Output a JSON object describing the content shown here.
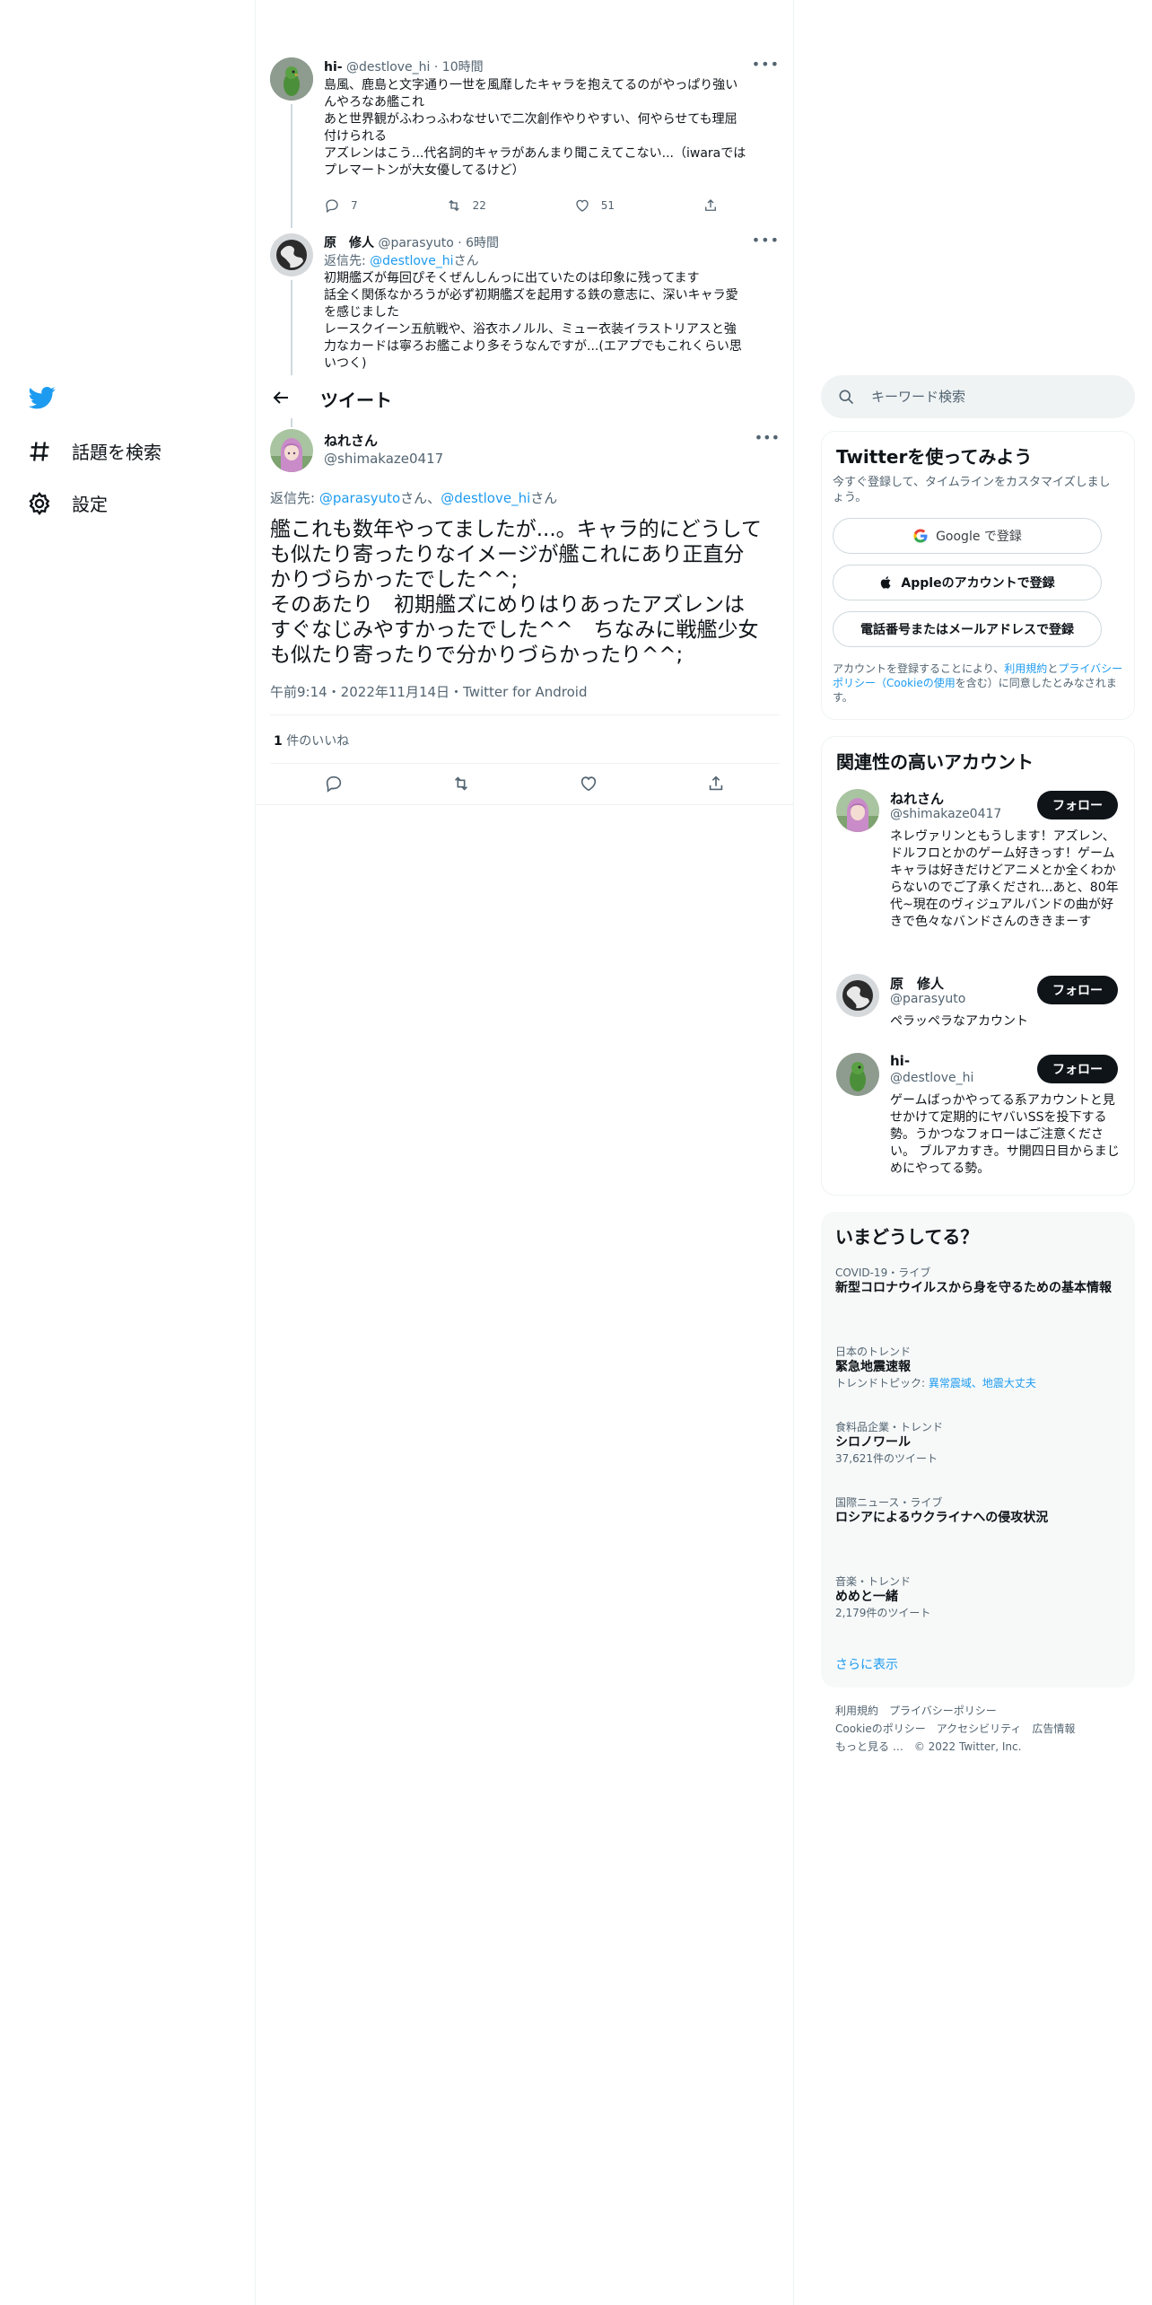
{
  "nav": {
    "explore_label": "話題を検索",
    "settings_label": "設定"
  },
  "thread": [
    {
      "name": "hi-",
      "handle": "@destlove_hi",
      "time": "10時間",
      "lines": [
        "島風、鹿島と文字通り一世を風靡したキャラを抱えてるのがやっぱり強い",
        "んやろなあ艦これ",
        "あと世界観がふわっふわなせいで二次創作やりやすい、何やらせても理屈",
        "付けられる",
        "アズレンはこう...代名詞的キャラがあんまり聞こえてこない...（iwaraでは",
        "プレマートンが大女優してるけど）"
      ],
      "replies": "7",
      "retweets": "22",
      "likes": "51"
    },
    {
      "name": "原　修人",
      "handle": "@parasyuto",
      "time": "6時間",
      "reply_prefix": "返信先: ",
      "reply_to": "@destlove_hi",
      "reply_suffix": "さん",
      "lines": [
        "初期艦ズが毎回ぴそくぜんしんっに出ていたのは印象に残ってます",
        "話全く関係なかろうが必ず初期艦ズを起用する鉄の意志に、深いキャラ愛",
        "を感じました",
        "レースクイーン五航戦や、浴衣ホノルル、ミュー衣装イラストリアスと強",
        "力なカードは寧ろお艦こより多そうなんですが...(エアプでもこれくらい思",
        "いつく)"
      ]
    }
  ],
  "header": {
    "title": "ツイート"
  },
  "focus": {
    "name": "ねれさん",
    "handle": "@shimakaze0417",
    "reply_prefix": "返信先: ",
    "reply_to_1": "@parasyuto",
    "reply_mid": "さん、",
    "reply_to_2": "@destlove_hi",
    "reply_suffix": "さん",
    "lines": [
      "艦これも数年やってましたが...。キャラ的にどうして",
      "も似たり寄ったりなイメージが艦これにあり正直分",
      "かりづらかったでした^^;",
      "そのあたり　初期艦ズにめりはりあったアズレンは",
      "すぐなじみやすかったでした^^　ちなみに戦艦少女",
      "も似たり寄ったりで分かりづらかったり^^;"
    ],
    "meta": "午前9:14・2022年11月14日・Twitter for Android",
    "likes_count": "1",
    "likes_label": " 件のいいね"
  },
  "search": {
    "placeholder": "キーワード検索"
  },
  "signup": {
    "title": "Twitterを使ってみよう",
    "desc": "今すぐ登録して、タイムラインをカスタマイズしましょう。",
    "google": "Google で登録",
    "apple": "Appleのアカウントで登録",
    "phone": "電話番号またはメールアドレスで登録",
    "terms_1": "アカウントを登録することにより、",
    "terms_link_1": "利用規約",
    "terms_2": "と",
    "terms_link_2": "プライバシーポリシー（Cookieの使用",
    "terms_3": "を含む）に同意したとみなされます。"
  },
  "relevant": {
    "title": "関連性の高いアカウント",
    "follow_label": "フォロー",
    "users": [
      {
        "name": "ねれさん",
        "handle": "@shimakaze0417",
        "bio": "ネレヴァリンともうします！アズレン、ドルフロとかのゲーム好きっす！ゲームキャラは好きだけどアニメとか全くわからないのでご了承くだされ...あと、80年代~現在のヴィジュアルバンドの曲が好きで色々なバンドさんのききまーす"
      },
      {
        "name": "原　修人",
        "handle": "@parasyuto",
        "bio": "ペラッペラなアカウント"
      },
      {
        "name": "hi-",
        "handle": "@destlove_hi",
        "bio": "ゲームばっかやってる系アカウントと見せかけて定期的にヤバいSSを投下する勢。うかつなフォローはご注意ください。 ブルアカすき。サ開四日目からまじめにやってる勢。"
      }
    ]
  },
  "trends": {
    "title": "いまどうしてる？",
    "items": [
      {
        "category": "COVID-19・ライブ",
        "title": "新型コロナウイルスから身を守るための基本情報",
        "sub": ""
      },
      {
        "category": "日本のトレンド",
        "title": "緊急地震速報",
        "sub_prefix": "トレンドトピック: ",
        "sub_links": "異常震域、地震大丈夫"
      },
      {
        "category": "食料品企業・トレンド",
        "title": "シロノワール",
        "sub": "37,621件のツイート"
      },
      {
        "category": "国際ニュース・ライブ",
        "title": "ロシアによるウクライナへの侵攻状況",
        "sub": ""
      },
      {
        "category": "音楽・トレンド",
        "title": "めめと一緒",
        "sub": "2,179件のツイート"
      }
    ],
    "show_more": "さらに表示"
  },
  "footer": {
    "links": [
      "利用規約",
      "プライバシーポリシー",
      "Cookieのポリシー",
      "アクセシビリティ",
      "広告情報",
      "もっと見る …"
    ],
    "copyright": "© 2022 Twitter, Inc."
  },
  "colors": {
    "accent": "#1d9bf0",
    "text": "#0f1419",
    "muted": "#536471"
  }
}
